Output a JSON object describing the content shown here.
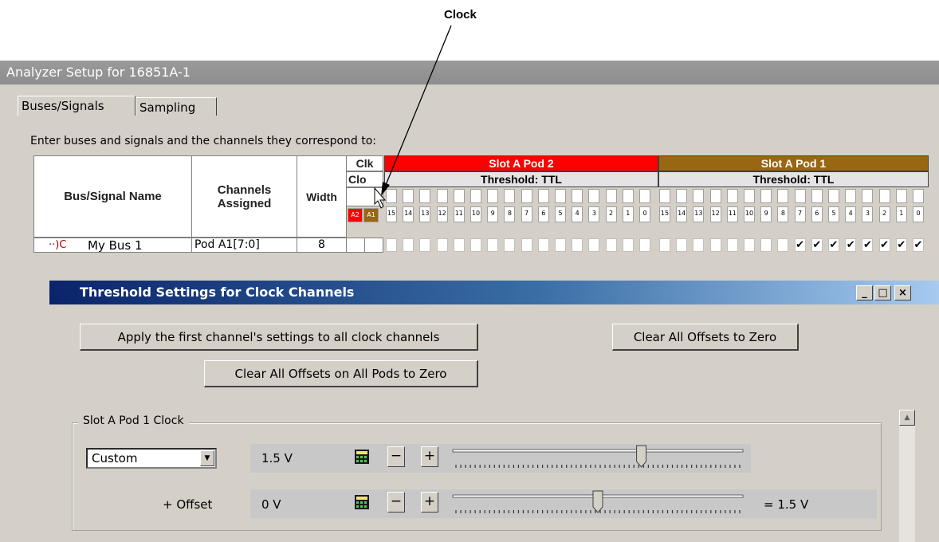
{
  "callout": {
    "label": "Clock"
  },
  "window": {
    "title": "Analyzer Setup for 16851A-1",
    "tabs": [
      {
        "label": "Buses/Signals"
      },
      {
        "label": "Sampling"
      }
    ],
    "instruction": "Enter buses and signals and the channels they correspond to:"
  },
  "grid": {
    "col_bus_name": "Bus/Signal Name",
    "col_channels": "Channels Assigned",
    "col_width": "Width",
    "clk_header": "Clk",
    "clo_header": "Clo",
    "clk_labels": [
      "A2",
      "A1"
    ],
    "pod2": {
      "title": "Slot A Pod 2",
      "threshold": "Threshold: TTL",
      "color": "#ff0000"
    },
    "pod1": {
      "title": "Slot A Pod 1",
      "threshold": "Threshold: TTL",
      "color": "#996611"
    },
    "channel_numbers": [
      "15",
      "14",
      "13",
      "12",
      "11",
      "10",
      "9",
      "8",
      "7",
      "6",
      "5",
      "4",
      "3",
      "2",
      "1",
      "0"
    ],
    "row": {
      "name": "My Bus 1",
      "channels": "Pod A1[7:0]",
      "width": "8",
      "checked_pod1": [
        "7",
        "6",
        "5",
        "4",
        "3",
        "2",
        "1",
        "0"
      ]
    }
  },
  "dialog": {
    "title": "Threshold Settings for Clock Channels",
    "btn_apply_first": "Apply the first channel's settings to all clock channels",
    "btn_clear_offsets": "Clear All Offsets to Zero",
    "btn_clear_all_pods": "Clear All Offsets on All Pods to Zero",
    "group_label": "Slot A Pod 1   Clock",
    "dropdown_value": "Custom",
    "threshold_value": "1.5 V",
    "threshold_level": 0.65,
    "offset_label": "+ Offset",
    "offset_value": "0 V",
    "offset_level": 0.5,
    "result_text": "=   1.5 V",
    "minus": "−",
    "plus": "+"
  }
}
